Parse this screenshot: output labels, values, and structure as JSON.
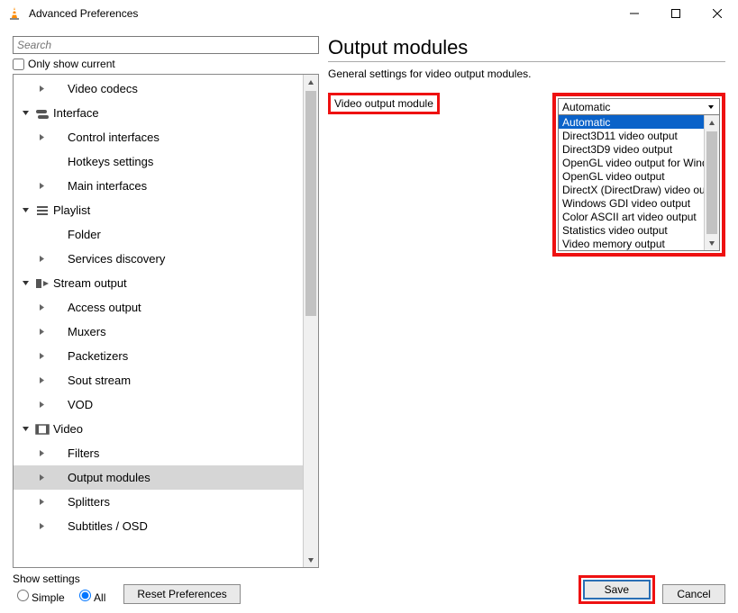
{
  "window": {
    "title": "Advanced Preferences"
  },
  "left": {
    "search_placeholder": "Search",
    "only_current_label": "Only show current",
    "tree": [
      {
        "indent": 1,
        "twisty": "right",
        "icon": "",
        "label": "Video codecs"
      },
      {
        "indent": 0,
        "twisty": "down",
        "icon": "interface",
        "label": "Interface"
      },
      {
        "indent": 1,
        "twisty": "right",
        "icon": "",
        "label": "Control interfaces"
      },
      {
        "indent": 1,
        "twisty": "none",
        "icon": "",
        "label": "Hotkeys settings"
      },
      {
        "indent": 1,
        "twisty": "right",
        "icon": "",
        "label": "Main interfaces"
      },
      {
        "indent": 0,
        "twisty": "down",
        "icon": "playlist",
        "label": "Playlist"
      },
      {
        "indent": 1,
        "twisty": "none",
        "icon": "",
        "label": "Folder"
      },
      {
        "indent": 1,
        "twisty": "right",
        "icon": "",
        "label": "Services discovery"
      },
      {
        "indent": 0,
        "twisty": "down",
        "icon": "stream",
        "label": "Stream output"
      },
      {
        "indent": 1,
        "twisty": "right",
        "icon": "",
        "label": "Access output"
      },
      {
        "indent": 1,
        "twisty": "right",
        "icon": "",
        "label": "Muxers"
      },
      {
        "indent": 1,
        "twisty": "right",
        "icon": "",
        "label": "Packetizers"
      },
      {
        "indent": 1,
        "twisty": "right",
        "icon": "",
        "label": "Sout stream"
      },
      {
        "indent": 1,
        "twisty": "right",
        "icon": "",
        "label": "VOD"
      },
      {
        "indent": 0,
        "twisty": "down",
        "icon": "video",
        "label": "Video"
      },
      {
        "indent": 1,
        "twisty": "right",
        "icon": "",
        "label": "Filters"
      },
      {
        "indent": 1,
        "twisty": "right",
        "icon": "",
        "label": "Output modules",
        "selected": true
      },
      {
        "indent": 1,
        "twisty": "right",
        "icon": "",
        "label": "Splitters"
      },
      {
        "indent": 1,
        "twisty": "right",
        "icon": "",
        "label": "Subtitles / OSD"
      }
    ]
  },
  "right": {
    "title": "Output modules",
    "subtitle": "General settings for video output modules.",
    "option_label": "Video output module",
    "combo_value": "Automatic",
    "dropdown": [
      {
        "label": "Automatic",
        "selected": true
      },
      {
        "label": "Direct3D11 video output"
      },
      {
        "label": "Direct3D9 video output"
      },
      {
        "label": "OpenGL video output for Windows"
      },
      {
        "label": "OpenGL video output"
      },
      {
        "label": "DirectX (DirectDraw) video output"
      },
      {
        "label": "Windows GDI video output"
      },
      {
        "label": "Color ASCII art video output"
      },
      {
        "label": "Statistics video output"
      },
      {
        "label": "Video memory output"
      }
    ]
  },
  "footer": {
    "show_settings_label": "Show settings",
    "simple_label": "Simple",
    "all_label": "All",
    "reset_label": "Reset Preferences",
    "save_label": "Save",
    "cancel_label": "Cancel"
  }
}
